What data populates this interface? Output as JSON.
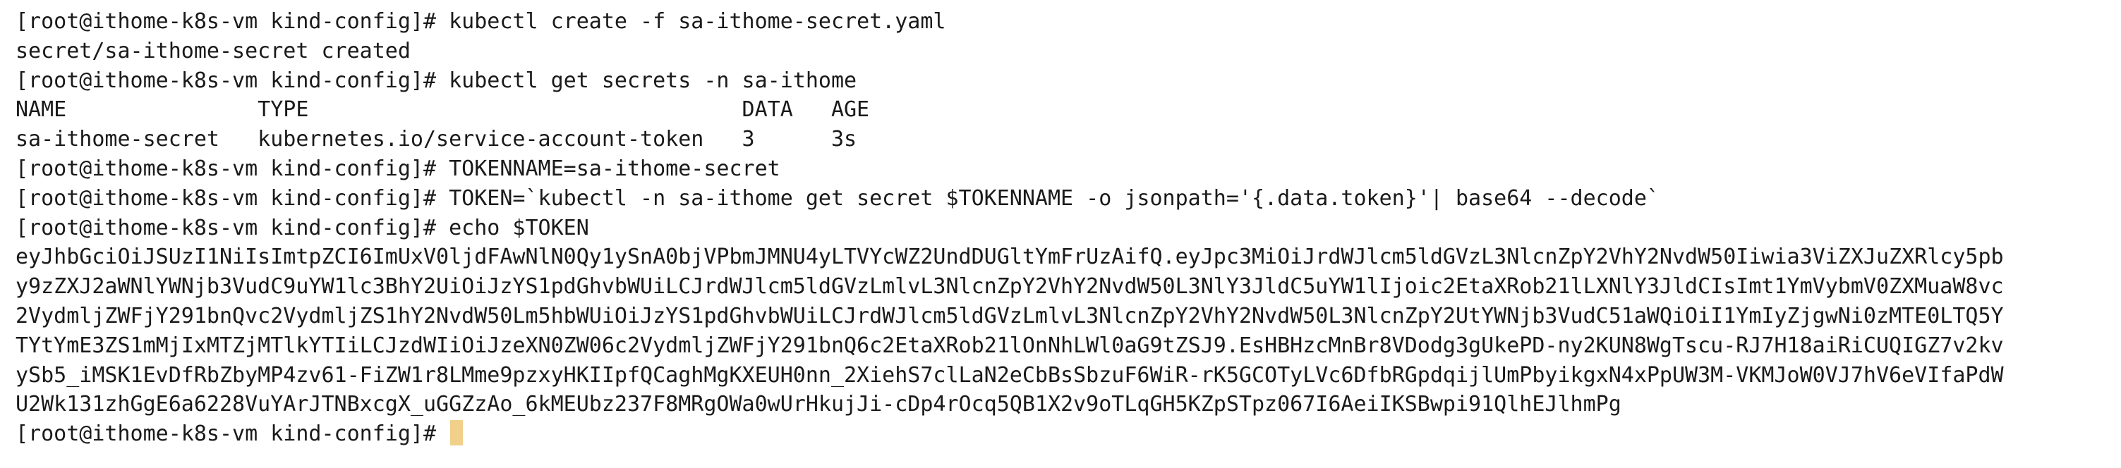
{
  "terminal": {
    "prompt": "[root@ithome-k8s-vm kind-config]# ",
    "cursor_color": "#f0d08a",
    "lines": [
      {
        "prompt": "[root@ithome-k8s-vm kind-config]# ",
        "text": "kubectl create -f sa-ithome-secret.yaml"
      },
      {
        "prompt": "",
        "text": "secret/sa-ithome-secret created"
      },
      {
        "prompt": "[root@ithome-k8s-vm kind-config]# ",
        "text": "kubectl get secrets -n sa-ithome"
      },
      {
        "prompt": "",
        "text": "NAME               TYPE                                  DATA   AGE"
      },
      {
        "prompt": "",
        "text": "sa-ithome-secret   kubernetes.io/service-account-token   3      3s"
      },
      {
        "prompt": "[root@ithome-k8s-vm kind-config]# ",
        "text": "TOKENNAME=sa-ithome-secret"
      },
      {
        "prompt": "[root@ithome-k8s-vm kind-config]# ",
        "text": "TOKEN=`kubectl -n sa-ithome get secret $TOKENNAME -o jsonpath='{.data.token}'| base64 --decode`"
      },
      {
        "prompt": "[root@ithome-k8s-vm kind-config]# ",
        "text": "echo $TOKEN"
      },
      {
        "prompt": "",
        "text": "eyJhbGciOiJSUzI1NiIsImtpZCI6ImUxV0ljdFAwNlN0Qy1ySnA0bjVPbmJMNU4yLTVYcWZ2UndDUGltYmFrUzAifQ.eyJpc3MiOiJrdWJlcm5ldGVzL3NlcnZpY2VhY2NvdW50Iiwia3ViZXJuZXRlcy5pb"
      },
      {
        "prompt": "",
        "text": "y9zZXJ2aWNlYWNjb3VudC9uYW1lc3BhY2UiOiJzYS1pdGhvbWUiLCJrdWJlcm5ldGVzLmlvL3NlcnZpY2VhY2NvdW50L3NlY3JldC5uYW1lIjoic2EtaXRob21lLXNlY3JldCIsImt1YmVybmV0ZXMuaW8vc"
      },
      {
        "prompt": "",
        "text": "2VydmljZWFjY291bnQvc2VydmljZS1hY2NvdW50Lm5hbWUiOiJzYS1pdGhvbWUiLCJrdWJlcm5ldGVzLmlvL3NlcnZpY2VhY2NvdW50L3NlcnZpY2UtYWNjb3VudC51aWQiOiI1YmIyZjgwNi0zMTE0LTQ5Y"
      },
      {
        "prompt": "",
        "text": "TYtYmE3ZS1mMjIxMTZjMTlkYTIiLCJzdWIiOiJzeXN0ZW06c2VydmljZWFjY291bnQ6c2EtaXRob21lOnNhLWl0aG9tZSJ9.EsHBHzcMnBr8VDodg3gUkePD-ny2KUN8WgTscu-RJ7H18aiRiCUQIGZ7v2kv"
      },
      {
        "prompt": "",
        "text": "ySb5_iMSK1EvDfRbZbyMP4zv61-FiZW1r8LMme9pzxyHKIIpfQCaghMgKXEUH0nn_2XiehS7clLaN2eCbBsSbzuF6WiR-rK5GCOTyLVc6DfbRGpdqijlUmPbyikgxN4xPpUW3M-VKMJoW0VJ7hV6eVIfaPdW"
      },
      {
        "prompt": "",
        "text": "U2Wk131zhGgE6a6228VuYArJTNBxcgX_uGGZzAo_6kMEUbz237F8MRgOWa0wUrHkujJi-cDp4rOcq5QB1X2v9oTLqGH5KZpSTpz067I6AeiIKSBwpi91QlhEJlhmPg"
      }
    ]
  }
}
